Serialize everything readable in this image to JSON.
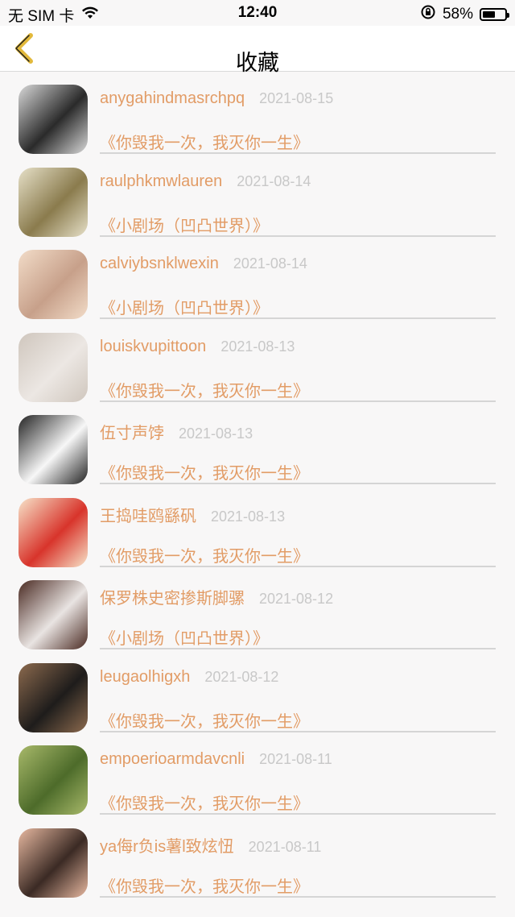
{
  "status_bar": {
    "carrier": "无 SIM 卡",
    "time": "12:40",
    "battery_percent": "58%",
    "battery_level": 0.58
  },
  "header": {
    "title": "收藏",
    "back_icon": "chevron-left-icon"
  },
  "colors": {
    "accent": "#e29c66",
    "date": "#c8c8c8",
    "divider": "#d5d5d5"
  },
  "favorites": [
    {
      "username": "anygahindmasrchpq",
      "date": "2021-08-15",
      "title": "《你毁我一次，我灭你一生》",
      "avatar_colors": [
        "#2a2a2a",
        "#d9d9d9"
      ]
    },
    {
      "username": "raulphkmwlauren",
      "date": "2021-08-14",
      "title": "《小剧场（凹凸世界）》",
      "avatar_colors": [
        "#8a7b4d",
        "#e6e0c8"
      ]
    },
    {
      "username": "calviybsnklwexin",
      "date": "2021-08-14",
      "title": "《小剧场（凹凸世界）》",
      "avatar_colors": [
        "#c7a08a",
        "#f2dcc8"
      ]
    },
    {
      "username": "louiskvupittoon",
      "date": "2021-08-13",
      "title": "《你毁我一次，我灭你一生》",
      "avatar_colors": [
        "#ece7e3",
        "#cfc6bd"
      ]
    },
    {
      "username": "伍寸声饽",
      "date": "2021-08-13",
      "title": "《你毁我一次，我灭你一生》",
      "avatar_colors": [
        "#f7f7f7",
        "#222222"
      ]
    },
    {
      "username": "王捣哇鸥繇矾",
      "date": "2021-08-13",
      "title": "《你毁我一次，我灭你一生》",
      "avatar_colors": [
        "#d8342b",
        "#f7e3c9"
      ]
    },
    {
      "username": "保罗株史密掺斯脚骡",
      "date": "2021-08-12",
      "title": "《小剧场（凹凸世界）》",
      "avatar_colors": [
        "#e9e4e2",
        "#4a2a22"
      ]
    },
    {
      "username": "leugaolhigxh",
      "date": "2021-08-12",
      "title": "《你毁我一次，我灭你一生》",
      "avatar_colors": [
        "#1e1c1b",
        "#8c6a4e"
      ]
    },
    {
      "username": "empoerioarmdavcnli",
      "date": "2021-08-11",
      "title": "《你毁我一次，我灭你一生》",
      "avatar_colors": [
        "#4d6b2a",
        "#a8b96a"
      ]
    },
    {
      "username": "ya侮r负is薯l致炫忸",
      "date": "2021-08-11",
      "title": "《你毁我一次，我灭你一生》",
      "avatar_colors": [
        "#3b2a24",
        "#e7b8a0"
      ]
    }
  ]
}
